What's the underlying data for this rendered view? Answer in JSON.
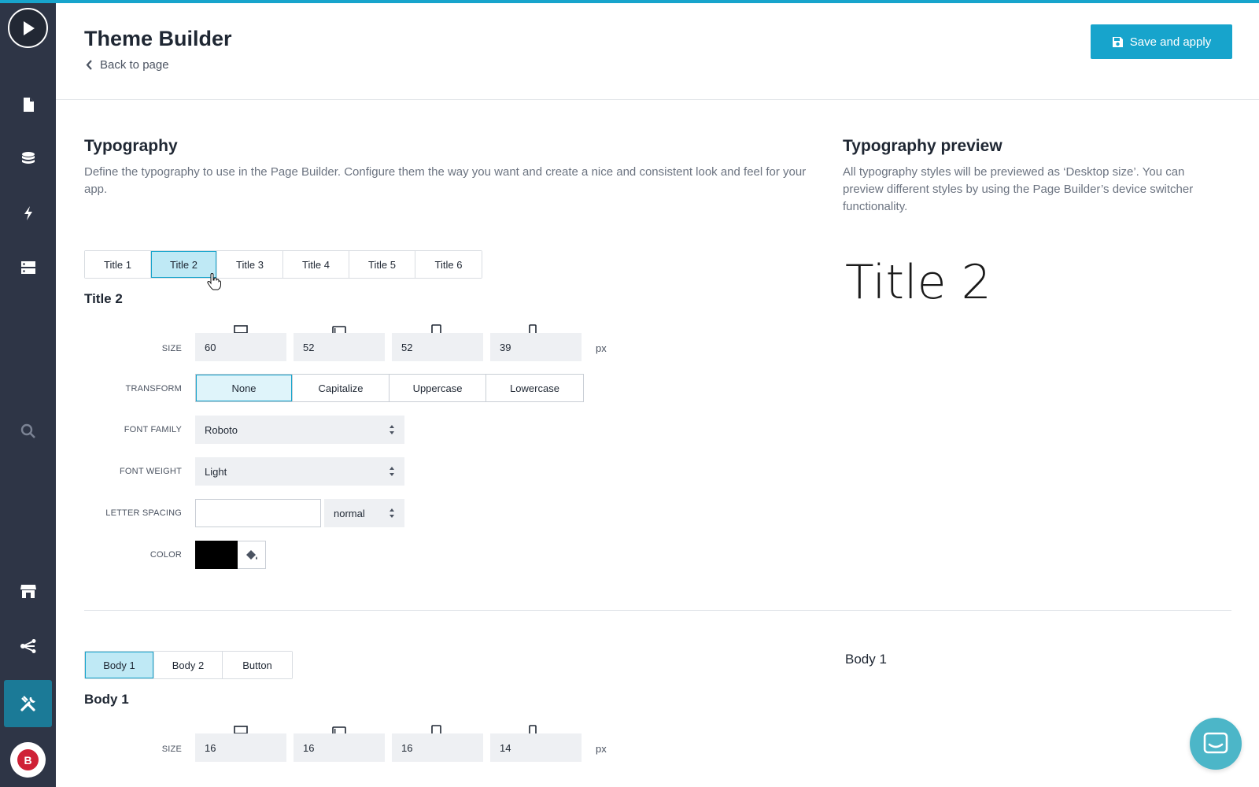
{
  "header": {
    "title": "Theme Builder",
    "back_label": "Back to page",
    "save_label": "Save and apply"
  },
  "sidebar": {
    "items": [
      {
        "icon": "play-logo-icon"
      },
      {
        "icon": "pages-icon"
      },
      {
        "icon": "database-icon"
      },
      {
        "icon": "actions-lightning-icon"
      },
      {
        "icon": "server-icon"
      },
      {
        "icon": "search-icon"
      },
      {
        "icon": "store-icon"
      },
      {
        "icon": "share-icon"
      },
      {
        "icon": "tools-icon",
        "active": true
      },
      {
        "icon": "account-avatar",
        "label": "B"
      }
    ]
  },
  "typography": {
    "title": "Typography",
    "description": "Define the typography to use in the Page Builder. Configure them the way you want and create a nice and consistent look and feel for your app.",
    "tabs": [
      "Title 1",
      "Title 2",
      "Title 3",
      "Title 4",
      "Title 5",
      "Title 6"
    ],
    "active_tab": "Title 2",
    "selected_title": "Title 2",
    "labels": {
      "size": "SIZE",
      "transform": "TRANSFORM",
      "font_family": "FONT FAMILY",
      "font_weight": "FONT WEIGHT",
      "letter_spacing": "LETTER SPACING",
      "color": "COLOR"
    },
    "sizes": [
      "60",
      "52",
      "52",
      "39"
    ],
    "unit": "px",
    "transform_options": [
      "None",
      "Capitalize",
      "Uppercase",
      "Lowercase"
    ],
    "transform_selected": "None",
    "font_family": "Roboto",
    "font_weight": "Light",
    "letter_spacing_value": "",
    "letter_spacing_unit": "normal",
    "color": "#000000"
  },
  "preview": {
    "title": "Typography preview",
    "description": "All typography styles will be previewed as ‘Desktop size’. You can preview different styles by using the Page Builder’s device switcher functionality.",
    "title_sample": "Title 2",
    "body_sample": "Body 1"
  },
  "body_section": {
    "tabs": [
      "Body 1",
      "Body 2",
      "Button"
    ],
    "active_tab": "Body 1",
    "selected_title": "Body 1",
    "size_label": "SIZE",
    "sizes": [
      "16",
      "16",
      "16",
      "14"
    ],
    "unit": "px"
  },
  "colors": {
    "accent": "#17a4cc",
    "sidebar": "#2e3546",
    "active_sidebar": "#1b7a97",
    "chat": "#4cb6c8"
  }
}
